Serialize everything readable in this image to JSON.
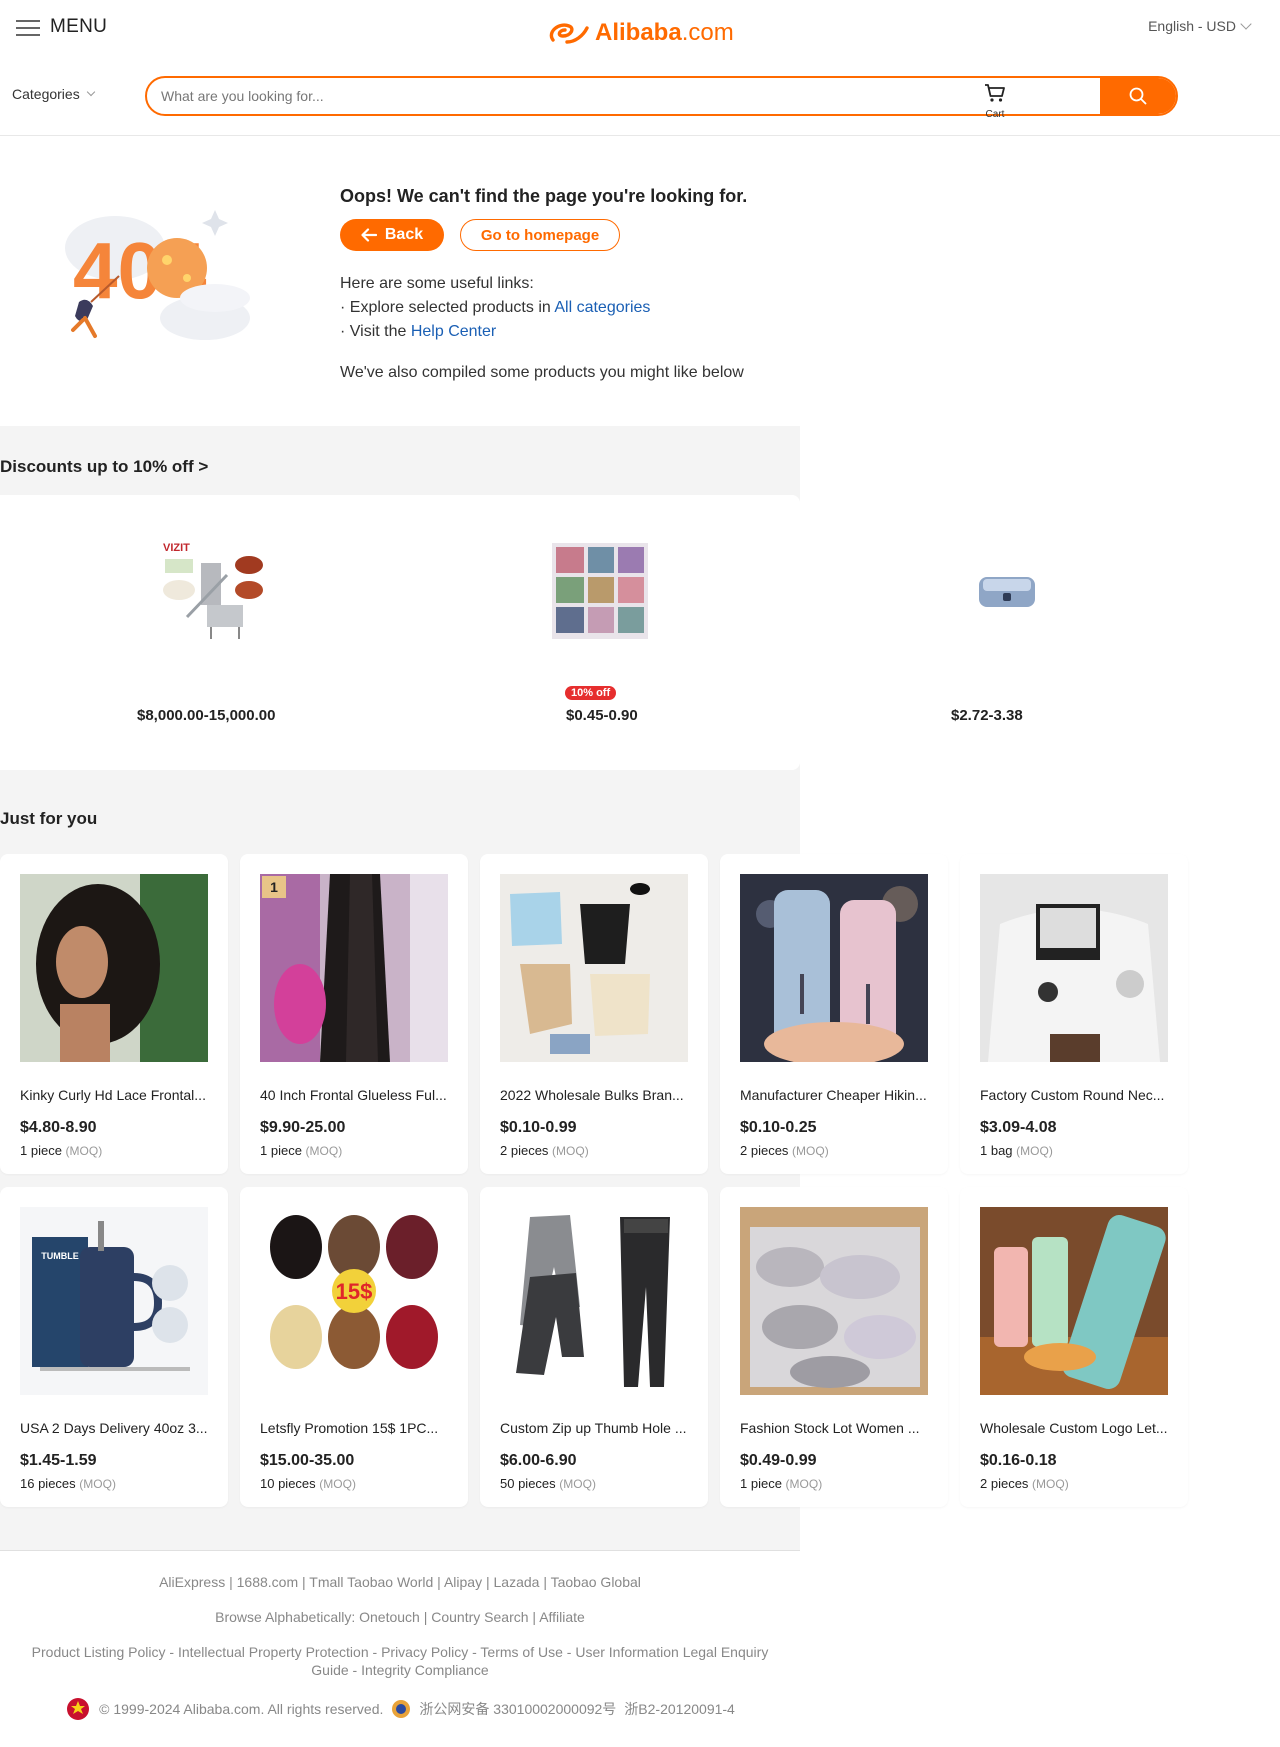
{
  "header": {
    "menu_label": "MENU",
    "logo_text": "Alibaba",
    "logo_suffix": ".com",
    "lang_currency": "English - USD",
    "categories_label": "Categories",
    "search_placeholder": "What are you looking for...",
    "cart_label": "Cart"
  },
  "error": {
    "title": "Oops! We can't find the page you're looking for.",
    "back_label": "Back",
    "home_label": "Go to homepage",
    "useful_intro": "Here are some useful links:",
    "link1_prefix": "· Explore selected products in ",
    "link1_text": "All categories",
    "link2_prefix": "· Visit the ",
    "link2_text": "Help Center",
    "compiled": "We've also compiled some products you might like below",
    "illus_text": "404"
  },
  "discounts": {
    "title": "Discounts up to 10%  off >",
    "items": [
      {
        "price": "$8,000.00-15,000.00",
        "badge": ""
      },
      {
        "price": "$0.45-0.90",
        "badge": "10% off"
      },
      {
        "price": "$2.72-3.38",
        "badge": ""
      }
    ]
  },
  "just_for_you": {
    "title": "Just for you",
    "moq_label": "(MOQ)",
    "products": [
      {
        "title": "Kinky Curly Hd Lace Frontal...",
        "price": "$4.80-8.90",
        "moq": "1 piece"
      },
      {
        "title": "40 Inch Frontal Glueless Ful...",
        "price": "$9.90-25.00",
        "moq": "1 piece",
        "badge": "1"
      },
      {
        "title": "2022 Wholesale Bulks Bran...",
        "price": "$0.10-0.99",
        "moq": "2 pieces"
      },
      {
        "title": "Manufacturer Cheaper Hikin...",
        "price": "$0.10-0.25",
        "moq": "2 pieces"
      },
      {
        "title": "Factory Custom Round Nec...",
        "price": "$3.09-4.08",
        "moq": "1 bag"
      },
      {
        "title": "USA 2 Days Delivery 40oz 3...",
        "price": "$1.45-1.59",
        "moq": "16 pieces",
        "img_text": "TUMBLE"
      },
      {
        "title": "Letsfly Promotion 15$ 1PC...",
        "price": "$15.00-35.00",
        "moq": "10 pieces",
        "img_text": "15$"
      },
      {
        "title": "Custom Zip up Thumb Hole ...",
        "price": "$6.00-6.90",
        "moq": "50 pieces"
      },
      {
        "title": "Fashion Stock Lot Women ...",
        "price": "$0.49-0.99",
        "moq": "1 piece"
      },
      {
        "title": "Wholesale Custom Logo Let...",
        "price": "$0.16-0.18",
        "moq": "2 pieces"
      }
    ]
  },
  "footer": {
    "line1": [
      "AliExpress",
      "1688.com",
      "Tmall Taobao World",
      "Alipay",
      "Lazada",
      "Taobao Global"
    ],
    "line2_prefix": "Browse Alphabetically: ",
    "line2": [
      "Onetouch",
      "Country Search",
      "Affiliate"
    ],
    "line3": [
      "Product Listing Policy",
      "Intellectual Property Protection",
      "Privacy Policy",
      "Terms of Use",
      "User Information Legal Enquiry Guide",
      "Integrity Compliance"
    ],
    "copyright": "© 1999-2024 Alibaba.com. All rights reserved.",
    "beian": "浙公网安备 33010002000092号",
    "icp": "浙B2-20120091-4"
  },
  "colors": {
    "accent": "#ff6a00",
    "link": "#1a5fb4",
    "badge": "#e62e2e"
  }
}
